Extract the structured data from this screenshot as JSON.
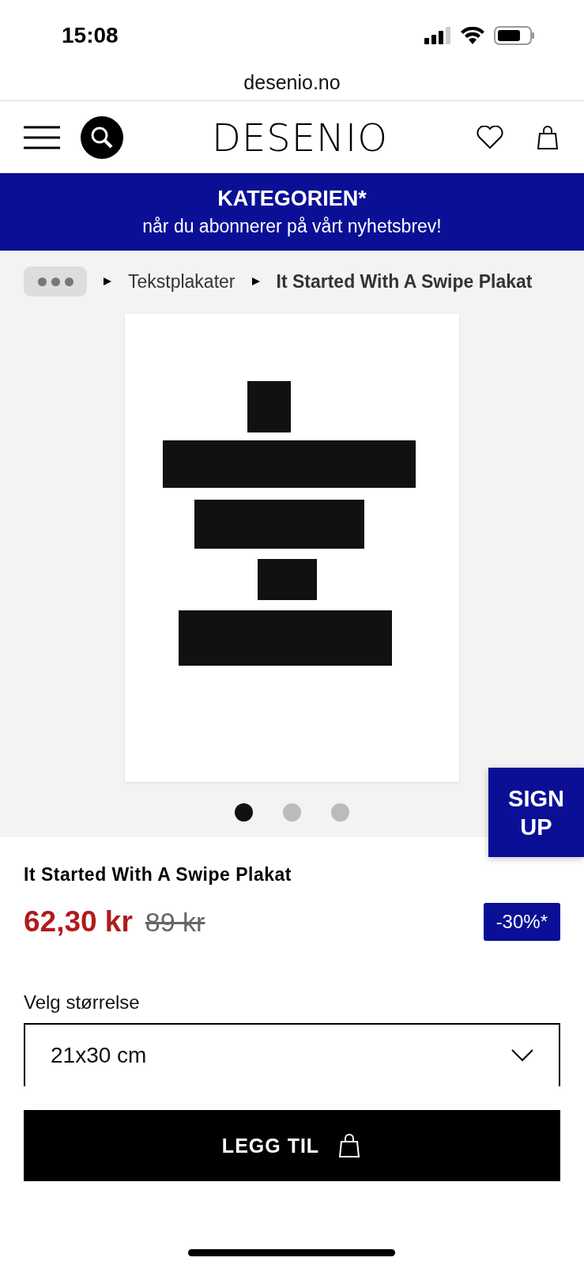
{
  "status_bar": {
    "time": "15:08"
  },
  "browser": {
    "url": "desenio.no"
  },
  "header": {
    "logo": "DESENIO"
  },
  "banner": {
    "title": "KATEGORIEN*",
    "subtitle": "når du abonnerer på vårt nyhetsbrev!"
  },
  "breadcrumbs": [
    "Tekstplakater",
    "It Started With A Swipe Plakat"
  ],
  "gallery": {
    "dots": [
      {
        "selected": true
      },
      {
        "selected": false
      },
      {
        "selected": false
      }
    ]
  },
  "signup": {
    "lines": [
      "SIGN",
      "UP"
    ]
  },
  "product": {
    "title": "It Started With A Swipe Plakat",
    "price": "62,30 kr",
    "old_price": "89 kr",
    "discount": "-30%*"
  },
  "size": {
    "label": "Velg størrelse",
    "value": "21x30 cm"
  },
  "add_button": {
    "label": "LEGG TIL"
  }
}
